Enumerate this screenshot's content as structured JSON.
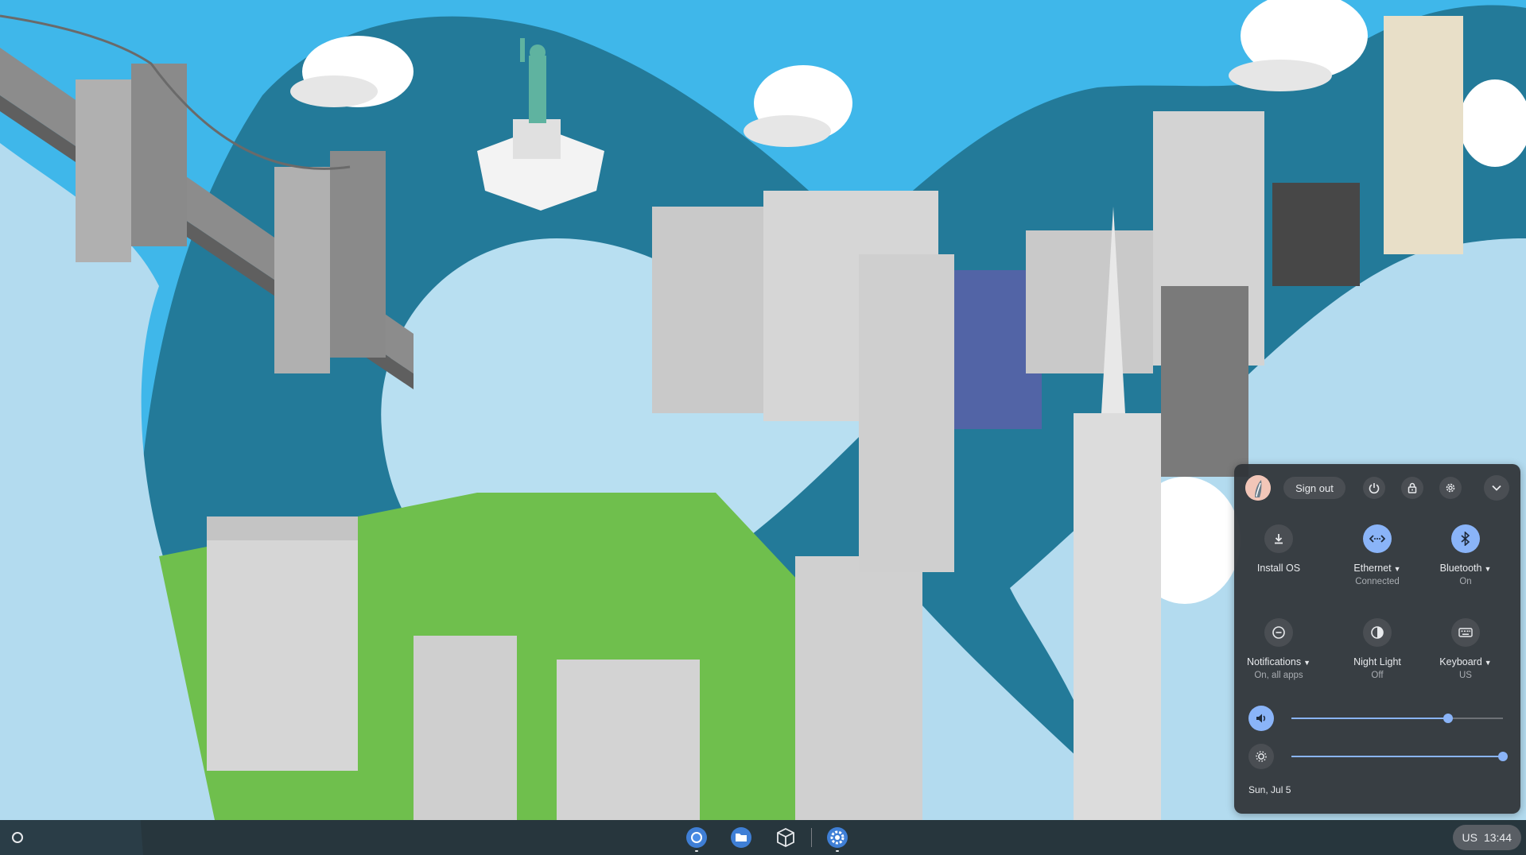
{
  "wallpaper": {
    "sky_color": "#3fb7ea",
    "shape_color": "#237a99",
    "fog_color": "#b3dbef"
  },
  "tray": {
    "sign_out_label": "Sign out",
    "top_icons": [
      "power-icon",
      "lock-icon",
      "gear-icon",
      "chevron-down-icon"
    ],
    "tiles": [
      {
        "label": "Install OS",
        "sublabel": "",
        "icon": "download-icon",
        "active": false,
        "has_menu": false
      },
      {
        "label": "Ethernet",
        "sublabel": "Connected",
        "icon": "ethernet-icon",
        "active": true,
        "has_menu": true
      },
      {
        "label": "Bluetooth",
        "sublabel": "On",
        "icon": "bluetooth-icon",
        "active": true,
        "has_menu": true
      },
      {
        "label": "Notifications",
        "sublabel": "On, all apps",
        "icon": "notifications-icon",
        "active": false,
        "has_menu": true
      },
      {
        "label": "Night Light",
        "sublabel": "Off",
        "icon": "night-light-icon",
        "active": false,
        "has_menu": false
      },
      {
        "label": "Keyboard",
        "sublabel": "US",
        "icon": "keyboard-icon",
        "active": false,
        "has_menu": true
      }
    ],
    "volume_level": 0.74,
    "brightness_level": 1.0,
    "date": "Sun, Jul 5",
    "accent_color": "#8ab4f8"
  },
  "shelf": {
    "apps": [
      "chrome-icon",
      "files-icon",
      "package-icon",
      "settings-icon"
    ],
    "status": {
      "ime": "US",
      "time": "13:44"
    }
  }
}
